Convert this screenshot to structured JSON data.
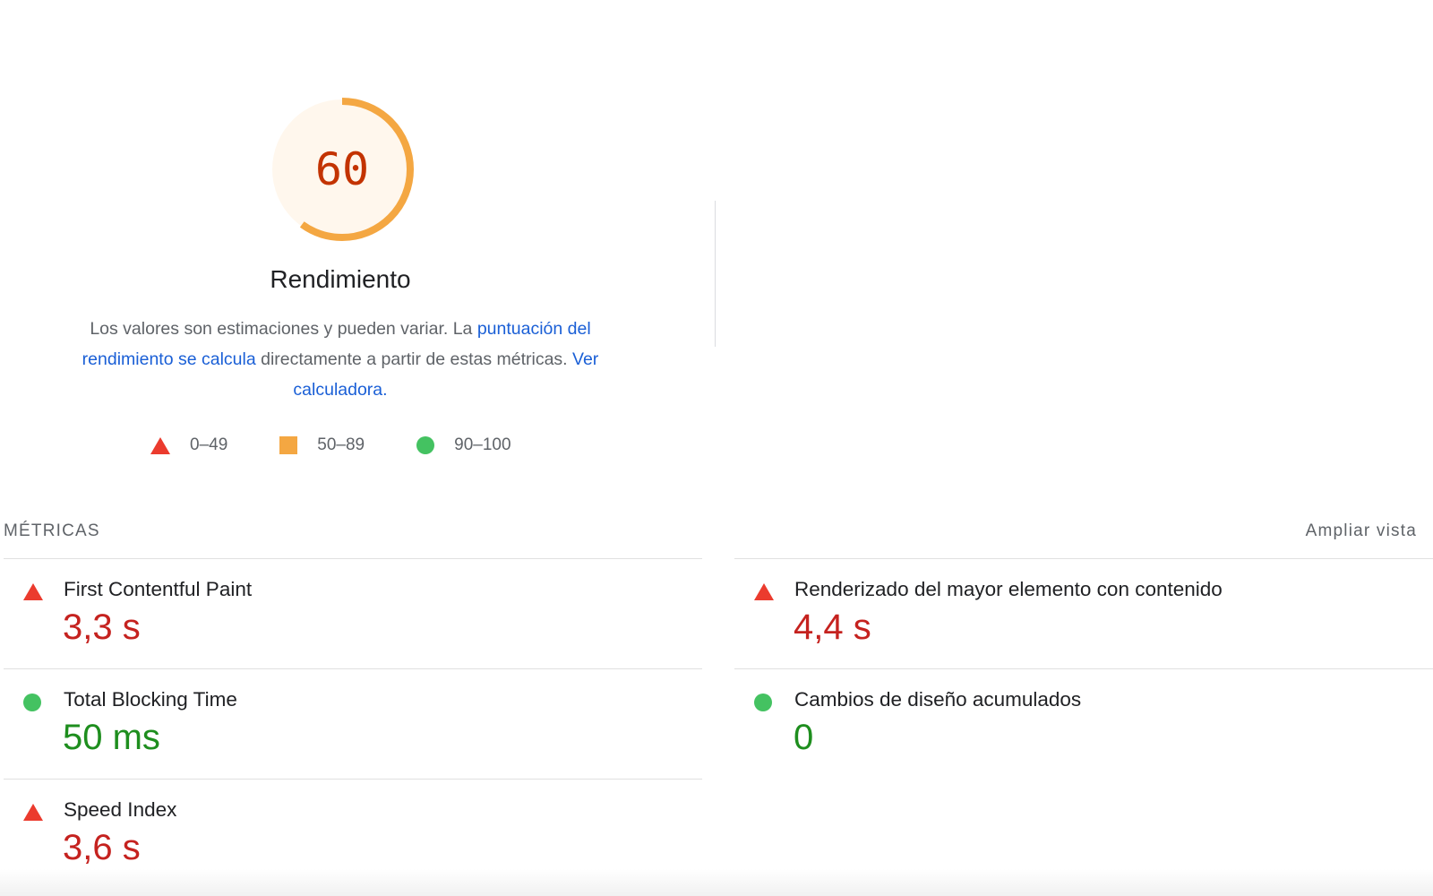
{
  "score": {
    "value": 60,
    "category_title": "Rendimiento",
    "accent_color": "#f4a742",
    "text_color": "#c33300",
    "background_color": "#fff7ed"
  },
  "description": {
    "text_1": "Los valores son estimaciones y pueden variar. La ",
    "link_1": "puntuación del rendimiento se calcula",
    "text_2": " directamente a partir de estas métricas. ",
    "link_2": "Ver calculadora."
  },
  "legend": [
    {
      "icon": "triangle-icon",
      "label": "0–49",
      "color": "#eb3b2e"
    },
    {
      "icon": "square-icon",
      "label": "50–89",
      "color": "#f4a742"
    },
    {
      "icon": "circle-icon",
      "label": "90–100",
      "color": "#44c261"
    }
  ],
  "metrics_section": {
    "title": "MÉTRICAS",
    "expand_label": "Ampliar vista"
  },
  "metrics": [
    {
      "name": "First Contentful Paint",
      "value": "3,3 s",
      "status": "fail"
    },
    {
      "name": "Renderizado del mayor elemento con contenido",
      "value": "4,4 s",
      "status": "fail"
    },
    {
      "name": "Total Blocking Time",
      "value": "50 ms",
      "status": "pass"
    },
    {
      "name": "Cambios de diseño acumulados",
      "value": "0",
      "status": "pass"
    },
    {
      "name": "Speed Index",
      "value": "3,6 s",
      "status": "fail"
    }
  ],
  "colors": {
    "fail": "#c5221f",
    "pass": "#1e8e1e",
    "link": "#1a5fd6"
  }
}
